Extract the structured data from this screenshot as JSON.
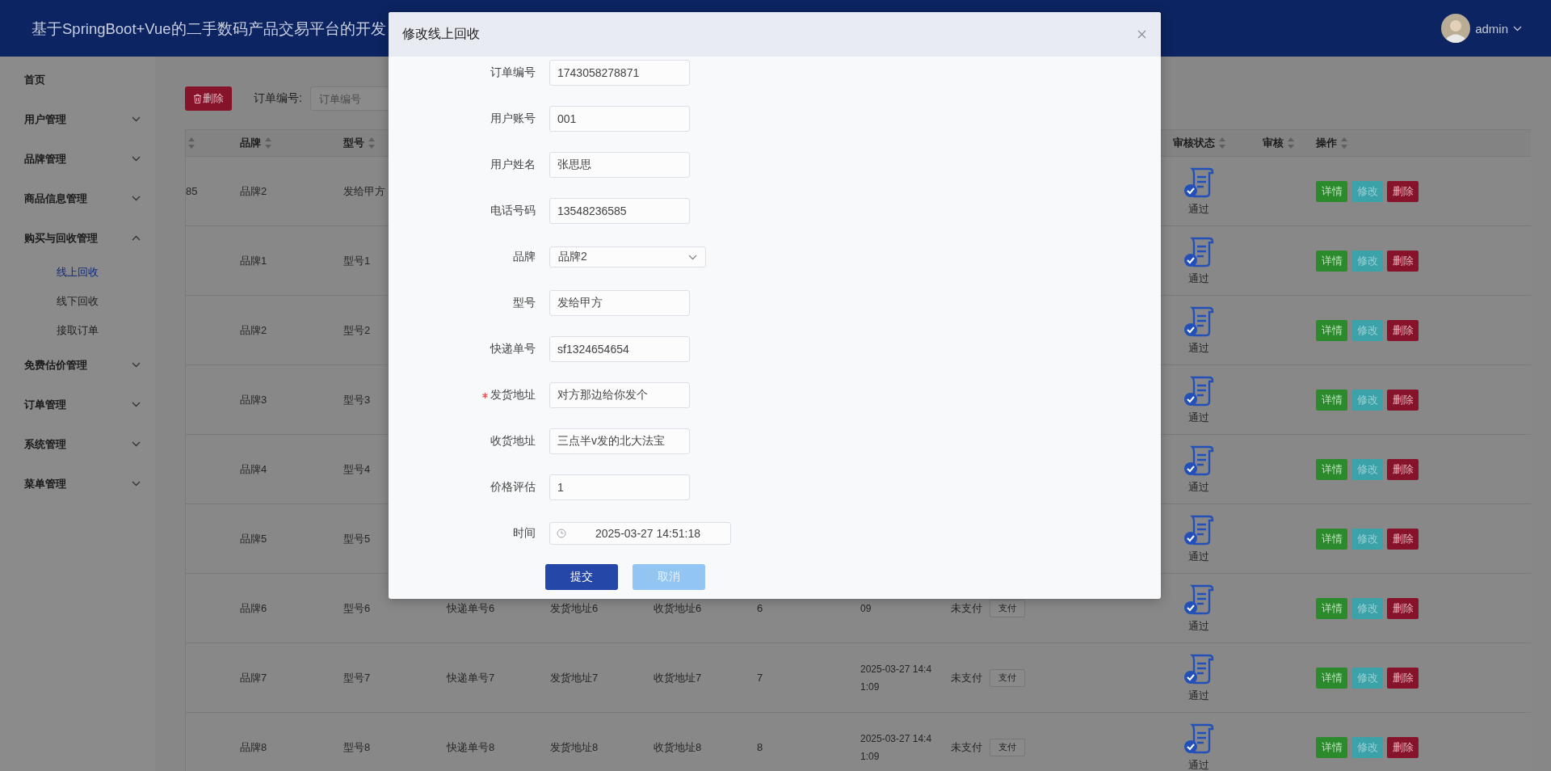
{
  "header": {
    "title": "基于SpringBoot+Vue的二手数码产品交易平台的开发",
    "user": {
      "name": "admin"
    }
  },
  "sidebar": {
    "items": [
      {
        "label": "首页"
      },
      {
        "label": "用户管理",
        "expanded": false
      },
      {
        "label": "品牌管理",
        "expanded": false
      },
      {
        "label": "商品信息管理",
        "expanded": false
      },
      {
        "label": "购买与回收管理",
        "expanded": true,
        "children": [
          {
            "label": "线上回收",
            "selected": true
          },
          {
            "label": "线下回收",
            "selected": false
          },
          {
            "label": "接取订单",
            "selected": false
          }
        ]
      },
      {
        "label": "免费估价管理",
        "expanded": false
      },
      {
        "label": "订单管理",
        "expanded": false
      },
      {
        "label": "系统管理",
        "expanded": false
      },
      {
        "label": "菜单管理",
        "expanded": false
      }
    ]
  },
  "toolbar": {
    "delete_button": "删除",
    "filters": [
      {
        "label": "订单编号:",
        "placeholder": "订单编号"
      }
    ]
  },
  "table": {
    "columns": {
      "column_1": {
        "sortable": true
      },
      "brand": {
        "label": "品牌",
        "sortable": true
      },
      "model": {
        "label": "型号",
        "sortable": true
      },
      "review_status": {
        "label": "审核状态",
        "sortable": true
      },
      "review": {
        "label": "审核",
        "sortable": true
      },
      "actions": {
        "label": "操作",
        "sortable": true
      }
    },
    "rows": [
      {
        "column_1": "85",
        "brand": "品牌2",
        "model": "发给甲方",
        "review_status": "通过",
        "actions": [
          {
            "label": "详情",
            "kind": "detail"
          },
          {
            "label": "修改",
            "kind": "edit"
          },
          {
            "label": "删除",
            "kind": "delete"
          }
        ]
      },
      {
        "brand": "品牌1",
        "model": "型号1",
        "review_status": "通过",
        "actions": [
          {
            "label": "详情",
            "kind": "detail"
          },
          {
            "label": "修改",
            "kind": "edit"
          },
          {
            "label": "删除",
            "kind": "delete"
          }
        ]
      },
      {
        "brand": "品牌2",
        "model": "型号2",
        "review_status": "通过",
        "actions": [
          {
            "label": "详情",
            "kind": "detail"
          },
          {
            "label": "修改",
            "kind": "edit"
          },
          {
            "label": "删除",
            "kind": "delete"
          }
        ]
      },
      {
        "brand": "品牌3",
        "model": "型号3",
        "review_status": "通过",
        "actions": [
          {
            "label": "详情",
            "kind": "detail"
          },
          {
            "label": "修改",
            "kind": "edit"
          },
          {
            "label": "删除",
            "kind": "delete"
          }
        ]
      },
      {
        "brand": "品牌4",
        "model": "型号4",
        "review_status": "通过",
        "actions": [
          {
            "label": "详情",
            "kind": "detail"
          },
          {
            "label": "修改",
            "kind": "edit"
          },
          {
            "label": "删除",
            "kind": "delete"
          }
        ]
      },
      {
        "brand": "品牌5",
        "model": "型号5",
        "review_status": "通过",
        "actions": [
          {
            "label": "详情",
            "kind": "detail"
          },
          {
            "label": "修改",
            "kind": "edit"
          },
          {
            "label": "删除",
            "kind": "delete"
          }
        ]
      },
      {
        "brand": "品牌6",
        "model": "型号6",
        "column_4": "快递单号6",
        "column_5": "发货地址6",
        "column_6": "收货地址6",
        "column_7": "6",
        "column_8": "09",
        "column_9": {
          "status": "未支付",
          "button": "支付"
        },
        "review_status": "通过",
        "actions": [
          {
            "label": "详情",
            "kind": "detail"
          },
          {
            "label": "修改",
            "kind": "edit"
          },
          {
            "label": "删除",
            "kind": "delete"
          }
        ]
      },
      {
        "brand": "品牌7",
        "model": "型号7",
        "column_4": "快递单号7",
        "column_5": "发货地址7",
        "column_6": "收货地址7",
        "column_7": "7",
        "column_8": "2025-03-27 14:41:09",
        "column_9": {
          "status": "未支付",
          "button": "支付"
        },
        "review_status": "通过",
        "actions": [
          {
            "label": "详情",
            "kind": "detail"
          },
          {
            "label": "修改",
            "kind": "edit"
          },
          {
            "label": "删除",
            "kind": "delete"
          }
        ]
      },
      {
        "brand": "品牌8",
        "model": "型号8",
        "column_4": "快递单号8",
        "column_5": "发货地址8",
        "column_6": "收货地址8",
        "column_7": "8",
        "column_8": "2025-03-27 14:41:09",
        "column_9": {
          "status": "未支付",
          "button": "支付"
        },
        "review_status": "通过",
        "actions": [
          {
            "label": "详情",
            "kind": "detail"
          },
          {
            "label": "修改",
            "kind": "edit"
          },
          {
            "label": "删除",
            "kind": "delete"
          }
        ]
      }
    ]
  },
  "dialog": {
    "title": "修改线上回收",
    "fields": [
      {
        "label": "订单编号",
        "kind": "text",
        "required": false,
        "value": "1743058278871"
      },
      {
        "label": "用户账号",
        "kind": "text",
        "required": false,
        "value": "001"
      },
      {
        "label": "用户姓名",
        "kind": "text",
        "required": false,
        "value": "张思思"
      },
      {
        "label": "电话号码",
        "kind": "text",
        "required": false,
        "value": "13548236585"
      },
      {
        "label": "品牌",
        "kind": "select",
        "required": false,
        "value": "品牌2"
      },
      {
        "label": "型号",
        "kind": "text",
        "required": false,
        "value": "发给甲方"
      },
      {
        "label": "快递单号",
        "kind": "text",
        "required": false,
        "value": "sf1324654654"
      },
      {
        "label": "发货地址",
        "kind": "text",
        "required": true,
        "value": "对方那边给你发个"
      },
      {
        "label": "收货地址",
        "kind": "text",
        "required": false,
        "value": "三点半v发的北大法宝"
      },
      {
        "label": "价格评估",
        "kind": "text",
        "required": false,
        "value": "1"
      },
      {
        "label": "时间",
        "kind": "datetime",
        "required": false,
        "value": "2025-03-27 14:51:18"
      }
    ],
    "buttons": [
      {
        "label": "提交",
        "kind": "primary"
      },
      {
        "label": "取消",
        "kind": "secondary"
      }
    ]
  }
}
